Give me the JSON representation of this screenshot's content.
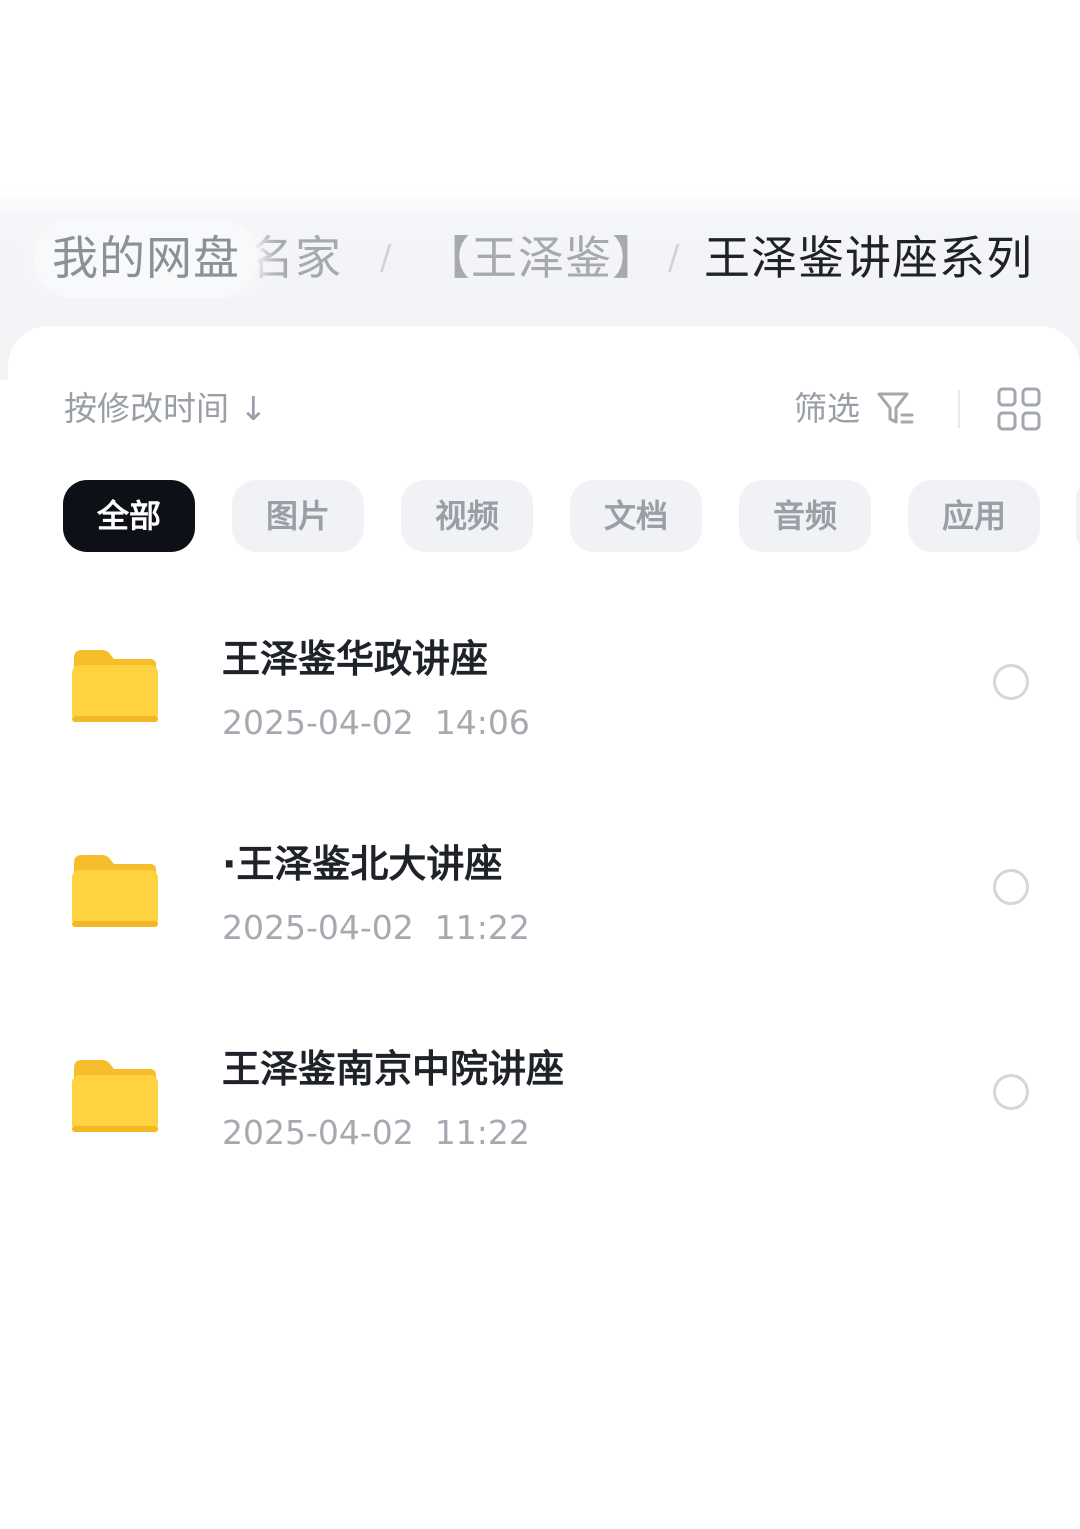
{
  "breadcrumb": {
    "home": "我的网盘",
    "level2": "名家",
    "level3": "【王泽鉴】",
    "current": "王泽鉴讲座系列",
    "separator": "/"
  },
  "toolbar": {
    "sort_label": "按修改时间",
    "sort_arrow": "↓",
    "filter_label": "筛选"
  },
  "tabs": [
    {
      "label": "全部",
      "active": true
    },
    {
      "label": "图片",
      "active": false
    },
    {
      "label": "视频",
      "active": false
    },
    {
      "label": "文档",
      "active": false
    },
    {
      "label": "音频",
      "active": false
    },
    {
      "label": "应用",
      "active": false
    }
  ],
  "files": [
    {
      "name": "王泽鉴华政讲座",
      "date": "2025-04-02  14:06",
      "icon": "folder-icon"
    },
    {
      "name": "·王泽鉴北大讲座",
      "date": "2025-04-02  11:22",
      "icon": "folder-icon"
    },
    {
      "name": "王泽鉴南京中院讲座",
      "date": "2025-04-02  11:22",
      "icon": "folder-icon"
    }
  ],
  "colors": {
    "folder": "#FFD23F",
    "folder_tab": "#F6BE2A",
    "active_tab_bg": "#0D1017",
    "chip_bg": "#F1F2F5"
  }
}
